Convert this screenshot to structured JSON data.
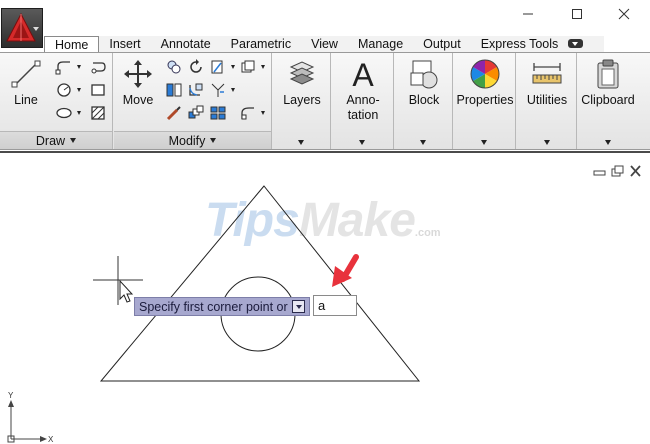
{
  "window": {
    "app_icon": "autocad-logo-icon",
    "controls": [
      "minimize-icon",
      "maximize-icon",
      "close-icon"
    ]
  },
  "tabs": [
    "Home",
    "Insert",
    "Annotate",
    "Parametric",
    "View",
    "Manage",
    "Output",
    "Express Tools"
  ],
  "active_tab": "Home",
  "ribbon": {
    "draw": {
      "title": "Draw",
      "line_label": "Line"
    },
    "modify": {
      "title": "Modify",
      "move_label": "Move"
    },
    "layers_label": "Layers",
    "annotation_label_1": "Anno-",
    "annotation_label_2": "tation",
    "block_label": "Block",
    "properties_label": "Properties",
    "utilities_label": "Utilities",
    "clipboard_label": "Clipboard"
  },
  "canvas": {
    "watermark_main_1": "Tips",
    "watermark_main_2": "Make",
    "watermark_suffix": ".com",
    "prompt_text": "Specify first corner point or",
    "input_value": "a",
    "ucs_y_label": "Y",
    "ucs_x_label": "X"
  },
  "colors": {
    "tooltip_bg": "#a7a8cf",
    "arrow_annotation": "#e8323c",
    "viewport_bg": "#ffffff"
  }
}
